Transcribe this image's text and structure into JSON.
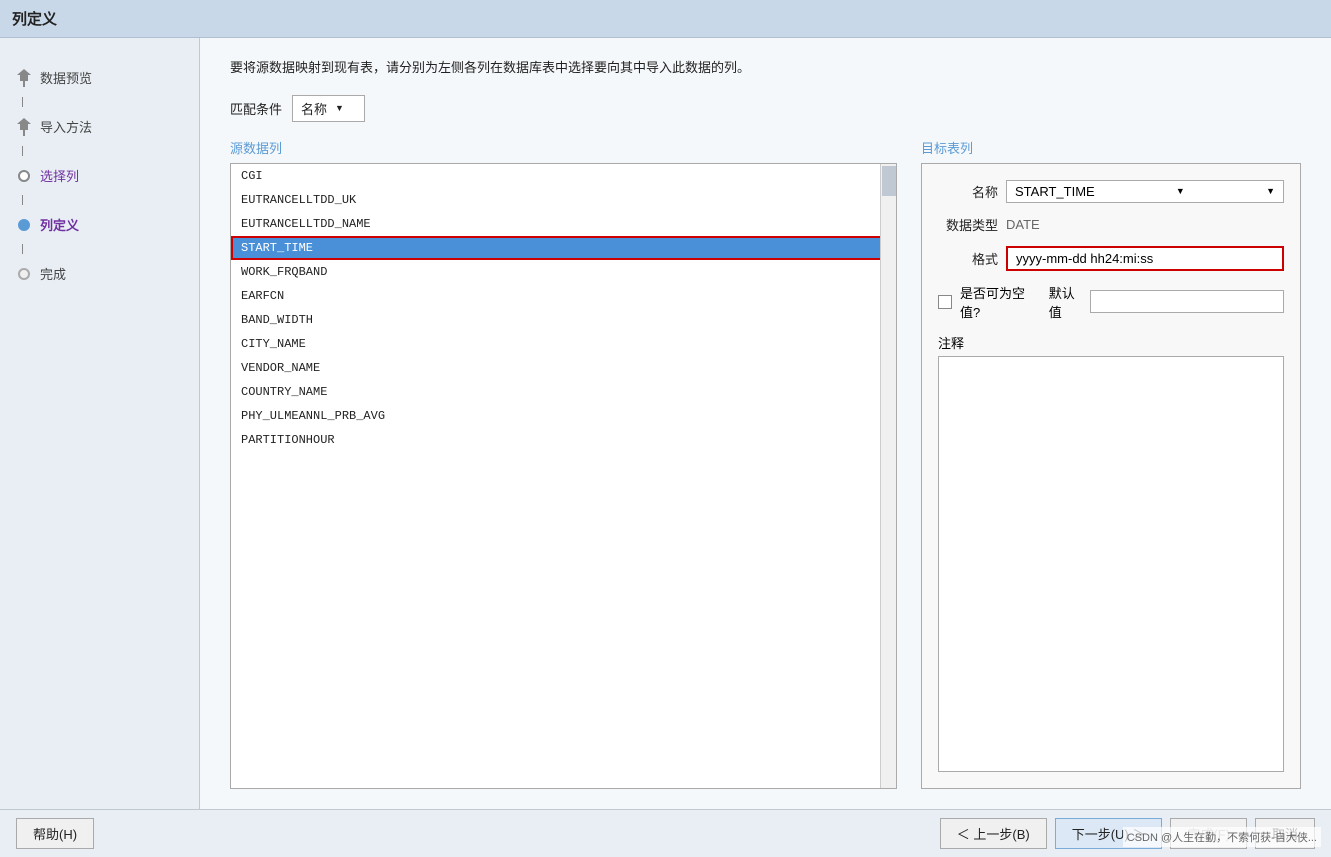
{
  "window": {
    "title": "列定义"
  },
  "sidebar": {
    "items": [
      {
        "id": "data-preview",
        "label": "数据预览",
        "state": "done",
        "icon": "pin"
      },
      {
        "id": "import-method",
        "label": "导入方法",
        "state": "done",
        "icon": "pin"
      },
      {
        "id": "select-columns",
        "label": "选择列",
        "state": "current-done",
        "icon": "circle"
      },
      {
        "id": "column-definition",
        "label": "列定义",
        "state": "active",
        "icon": "circle-filled"
      },
      {
        "id": "finish",
        "label": "完成",
        "state": "pending",
        "icon": "circle"
      }
    ]
  },
  "main": {
    "description": "要将源数据映射到现有表，请分别为左侧各列在数据库表中选择要向其中导入此数据的列。",
    "match_condition": {
      "label": "匹配条件",
      "value": "名称",
      "options": [
        "名称"
      ]
    },
    "source_section": {
      "title": "源数据列",
      "items": [
        "CGI",
        "EUTRANCELLTDD_UK",
        "EUTRANCELLTDD_NAME",
        "START_TIME",
        "WORK_FRQBAND",
        "EARFCN",
        "BAND_WIDTH",
        "CITY_NAME",
        "VENDOR_NAME",
        "COUNTRY_NAME",
        "PHY_ULMEANNL_PRB_AVG",
        "PARTITIONHOUR"
      ],
      "selected_index": 3,
      "selected_value": "START_TIME"
    },
    "target_section": {
      "title": "目标表列",
      "fields": {
        "name_label": "名称",
        "name_value": "START_TIME",
        "datatype_label": "数据类型",
        "datatype_value": "DATE",
        "format_label": "格式",
        "format_value": "yyyy-mm-dd hh24:mi:ss",
        "nullable_label": "是否可为空值?",
        "default_label": "默认值",
        "default_value": "",
        "notes_label": "注释"
      }
    }
  },
  "bottom": {
    "help_label": "帮助(H)",
    "prev_label": "＜ 上一步(B)",
    "next_label": "下一步(U) ＞",
    "finish_label": "完成(F)",
    "cancel_label": "取消"
  },
  "watermark": "CSDN @人生在勤，不索何获-自大侠..."
}
